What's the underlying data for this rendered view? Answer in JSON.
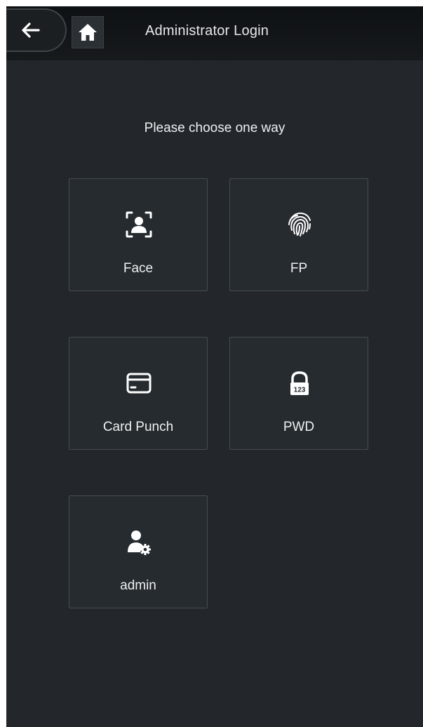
{
  "header": {
    "title": "Administrator Login",
    "back_icon": "arrow-left-icon",
    "home_icon": "home-icon"
  },
  "main": {
    "prompt": "Please choose one way",
    "options": [
      {
        "label": "Face",
        "icon": "face-scan-icon"
      },
      {
        "label": "FP",
        "icon": "fingerprint-icon"
      },
      {
        "label": "Card Punch",
        "icon": "card-icon"
      },
      {
        "label": "PWD",
        "icon": "password-lock-icon"
      },
      {
        "label": "admin",
        "icon": "admin-user-gear-icon"
      }
    ]
  },
  "colors": {
    "background": "#23272b",
    "header": "#111416",
    "tile": "#262b2f",
    "tile_border": "#454b50",
    "text": "#eef0f2"
  }
}
